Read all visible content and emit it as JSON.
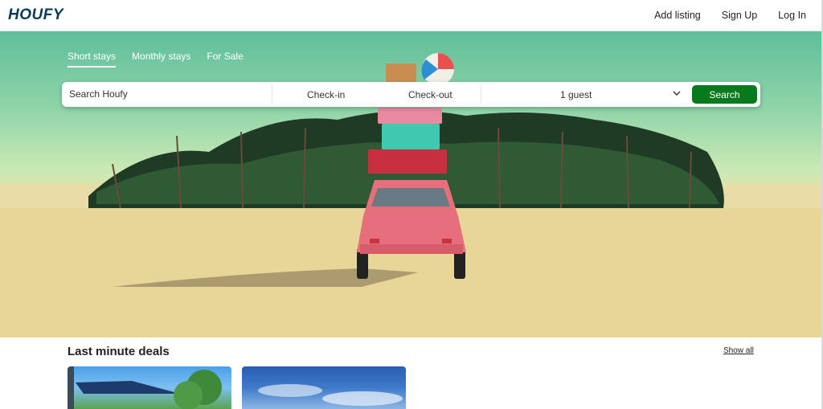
{
  "header": {
    "logo": "HOUFY",
    "nav": [
      "Add listing",
      "Sign Up",
      "Log In"
    ]
  },
  "hero": {
    "stay_tabs": [
      {
        "label": "Short stays",
        "active": true
      },
      {
        "label": "Monthly stays",
        "active": false
      },
      {
        "label": "For Sale",
        "active": false
      }
    ]
  },
  "search": {
    "placeholder": "Search Houfy",
    "checkin": "Check-in",
    "checkout": "Check-out",
    "guests": "1 guest",
    "button": "Search"
  },
  "deals": {
    "title": "Last minute deals",
    "show_all": "Show all"
  },
  "colors": {
    "brand": "#0b3a54",
    "search_button": "#077a1d"
  }
}
